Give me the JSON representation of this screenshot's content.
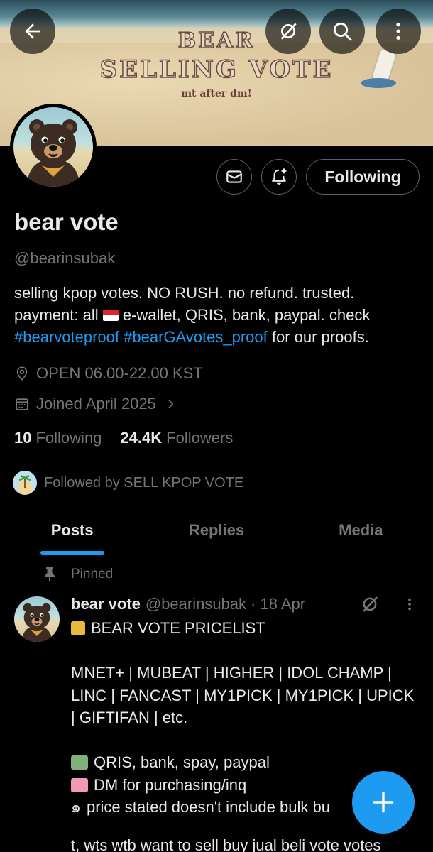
{
  "banner": {
    "title_line1": "BEAR",
    "title_line2": "SELLING VOTE",
    "subtitle": "mt after dm!"
  },
  "topbar": {
    "back_icon": "arrow-left-icon",
    "grok_icon": "grok-icon",
    "search_icon": "search-icon",
    "more_icon": "more-vertical-icon"
  },
  "profile": {
    "display_name": "bear vote",
    "handle": "@bearinsubak",
    "bio_line1": "selling kpop votes. NO RUSH. no refund. trusted.",
    "bio_payment_prefix": "payment: all",
    "bio_payment_suffix": " e-wallet, QRIS, bank, paypal. check",
    "bio_tag1": "#bearvoteproof",
    "bio_tag2": "#bearGAvotes_proof",
    "bio_tail": " for our proofs.",
    "location": "OPEN 06.00-22.00 KST",
    "joined": "Joined April 2025",
    "following_count": "10",
    "following_label": "Following",
    "followers_count": "24.4K",
    "followers_label": "Followers",
    "followed_by": "Followed by SELL KPOP VOTE"
  },
  "actions": {
    "following_button": "Following"
  },
  "tabs": [
    {
      "label": "Posts",
      "active": true
    },
    {
      "label": "Replies",
      "active": false
    },
    {
      "label": "Media",
      "active": false
    }
  ],
  "post": {
    "pinned_label": "Pinned",
    "author_name": "bear vote",
    "author_handle": "@bearinsubak",
    "date": "· 18 Apr",
    "line1": "BEAR VOTE PRICELIST",
    "line2": "MNET+ | MUBEAT | HIGHER | IDOL CHAMP |",
    "line3": "LINC | FANCAST | MY1PICK | MY1PICK | UPICK",
    "line4": "| GIFTIFAN | etc.",
    "line5": "QRIS, bank, spay, paypal",
    "line6": "DM for purchasing/inq",
    "line7": "price stated doesn't include bulk bu",
    "line7_prefix": "๑",
    "line8": "t, wts wtb want to sell buy jual beli vote votes"
  },
  "colors": {
    "accent": "#1d9bf0",
    "text_primary": "#e7e9ea",
    "text_secondary": "#71767b",
    "border": "#2f3336"
  }
}
